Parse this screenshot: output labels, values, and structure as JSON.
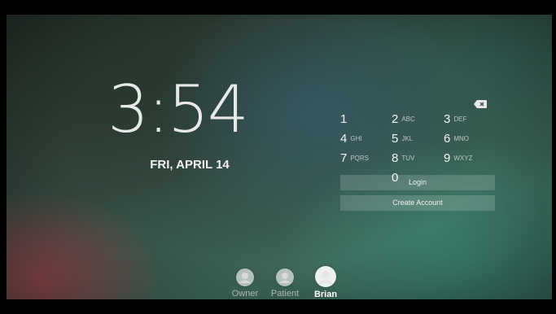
{
  "lockscreen": {
    "time": "3:54",
    "date": "FRI, APRIL 14"
  },
  "keypad": {
    "backspace_icon": "backspace-icon",
    "keys": [
      {
        "number": "1",
        "letters": ""
      },
      {
        "number": "2",
        "letters": "ABC"
      },
      {
        "number": "3",
        "letters": "DEF"
      },
      {
        "number": "4",
        "letters": "GHI"
      },
      {
        "number": "5",
        "letters": "JKL"
      },
      {
        "number": "6",
        "letters": "MNO"
      },
      {
        "number": "7",
        "letters": "PQRS"
      },
      {
        "number": "8",
        "letters": "TUV"
      },
      {
        "number": "9",
        "letters": "WXYZ"
      },
      {
        "number": "0",
        "letters": ""
      }
    ]
  },
  "actions": {
    "login_label": "Login",
    "create_account_label": "Create Account"
  },
  "users": [
    {
      "name": "Owner",
      "icon": "user-avatar-icon",
      "selected": false
    },
    {
      "name": "Patient",
      "icon": "user-avatar-icon",
      "selected": false
    },
    {
      "name": "Brian",
      "icon": "user-avatar-icon",
      "selected": true
    }
  ],
  "colors": {
    "text": "#f2f2f2",
    "button_bg": "rgba(255,255,255,0.16)"
  }
}
